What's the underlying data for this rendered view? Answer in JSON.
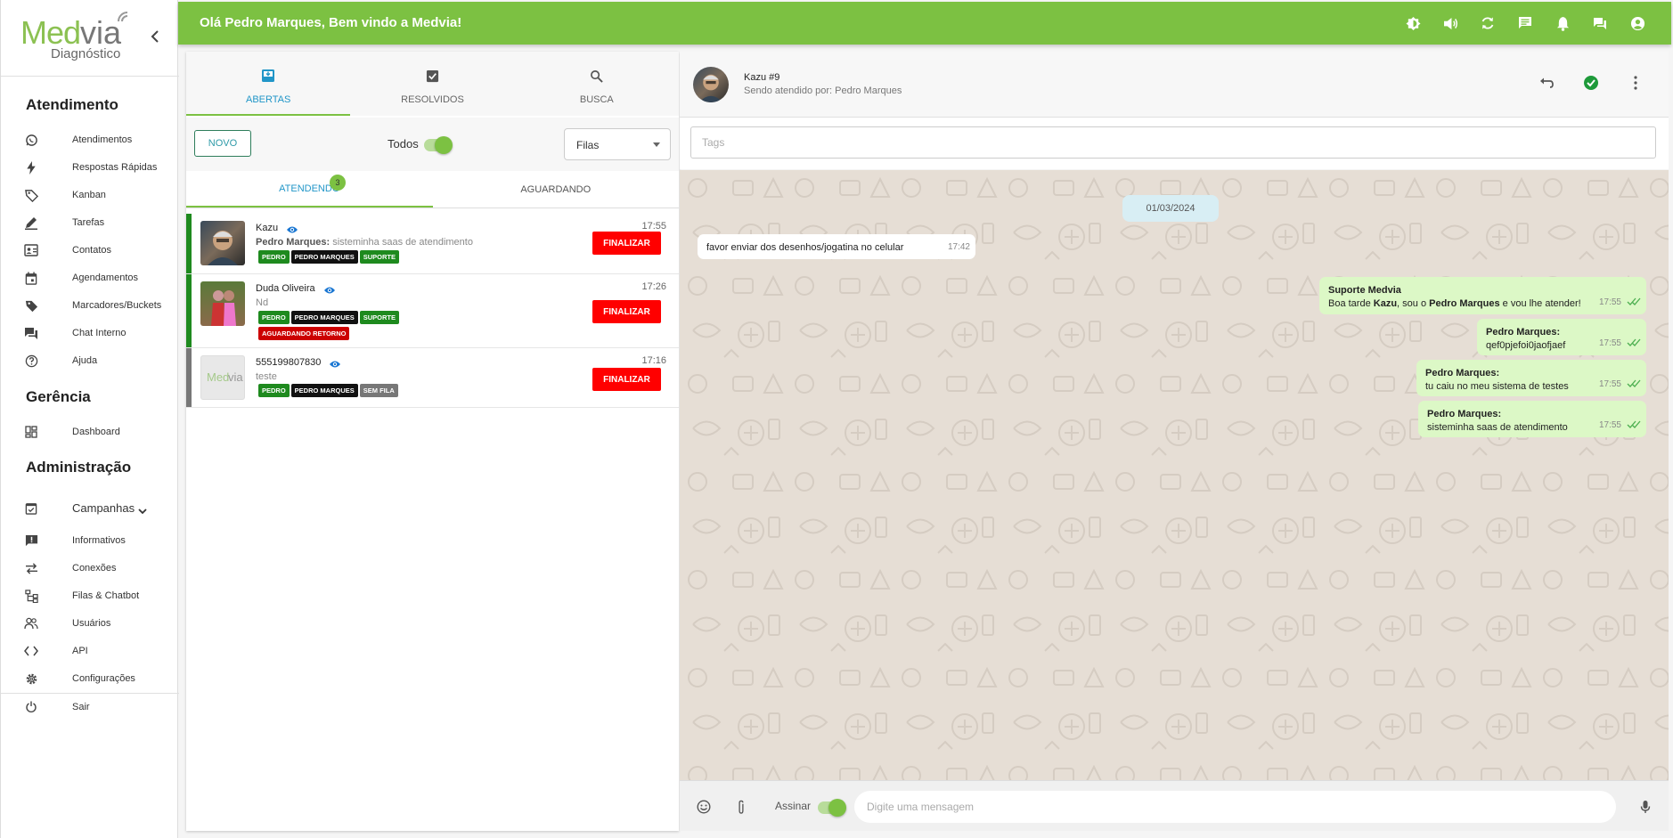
{
  "sidebar": {
    "logo_med": "Med",
    "logo_via": "via",
    "logo_sub": "Diagnóstico",
    "sections": {
      "atendimento": "Atendimento",
      "gerencia": "Gerência",
      "administracao": "Administração"
    },
    "items": {
      "atendimentos": "Atendimentos",
      "respostas": "Respostas Rápidas",
      "kanban": "Kanban",
      "tarefas": "Tarefas",
      "contatos": "Contatos",
      "agendamentos": "Agendamentos",
      "marcadores": "Marcadores/Buckets",
      "chat_interno": "Chat Interno",
      "ajuda": "Ajuda",
      "dashboard": "Dashboard",
      "campanhas": "Campanhas",
      "informativos": "Informativos",
      "conexoes": "Conexões",
      "filas": "Filas & Chatbot",
      "usuarios": "Usuários",
      "api": "API",
      "configuracoes": "Configurações",
      "sair": "Sair"
    }
  },
  "topbar": {
    "greeting": "Olá Pedro Marques, Bem vindo a Medvia!"
  },
  "tickets_panel": {
    "tabs": {
      "abertas": "ABERTAS",
      "resolvidos": "RESOLVIDOS",
      "busca": "BUSCA"
    },
    "novo": "NOVO",
    "todos": "Todos",
    "filas": "Filas",
    "subtabs": {
      "atendendo": "ATENDENDO",
      "aguardando": "AGUARDANDO",
      "count": "3"
    },
    "finalizar": "FINALIZAR",
    "tickets": [
      {
        "name": "Kazu",
        "preview_author": "Pedro Marques:",
        "preview_text": " sisteminha saas de atendimento",
        "time": "17:55",
        "tags": [
          "PEDRO",
          "PEDRO MARQUES",
          "SUPORTE"
        ]
      },
      {
        "name": "Duda Oliveira",
        "preview_text": "Nd",
        "time": "17:26",
        "tags": [
          "PEDRO",
          "PEDRO MARQUES",
          "SUPORTE"
        ],
        "tags2": [
          "AGUARDANDO RETORNO"
        ]
      },
      {
        "name": "555199807830",
        "preview_text": "teste",
        "time": "17:16",
        "tags": [
          "PEDRO",
          "PEDRO MARQUES",
          "SEM FILA"
        ]
      }
    ]
  },
  "chat": {
    "title": "Kazu #9",
    "subtitle": "Sendo atendido por: Pedro Marques",
    "tags_placeholder": "Tags",
    "date": "01/03/2024",
    "messages": [
      {
        "text": "favor enviar dos desenhos/jogatina no celular",
        "time": "17:42"
      },
      {
        "author": "Suporte Medvia",
        "pre": "Boa tarde ",
        "b1": "Kazu",
        "mid": ", sou o ",
        "b2": "Pedro Marques",
        "post": " e vou lhe atender!",
        "time": "17:55"
      },
      {
        "author": "Pedro Marques:",
        "text": "qef0pjefoi0jaofjaef",
        "time": "17:55"
      },
      {
        "author": "Pedro Marques:",
        "text": "tu caiu no meu sistema de testes",
        "time": "17:55"
      },
      {
        "author": "Pedro Marques:",
        "text": "sisteminha saas de atendimento",
        "time": "17:55"
      }
    ],
    "assinar": "Assinar",
    "message_placeholder": "Digite uma mensagem"
  },
  "colors": {
    "brand_green": "#7cc142",
    "accent_blue": "#2196c8",
    "finalizar_red": "#ff0000",
    "tag_green": "#1e8a1e",
    "tag_black": "#111111",
    "tag_gray": "#777777",
    "tag_red": "#cc0000",
    "bubble_out": "#dcf8c6"
  }
}
